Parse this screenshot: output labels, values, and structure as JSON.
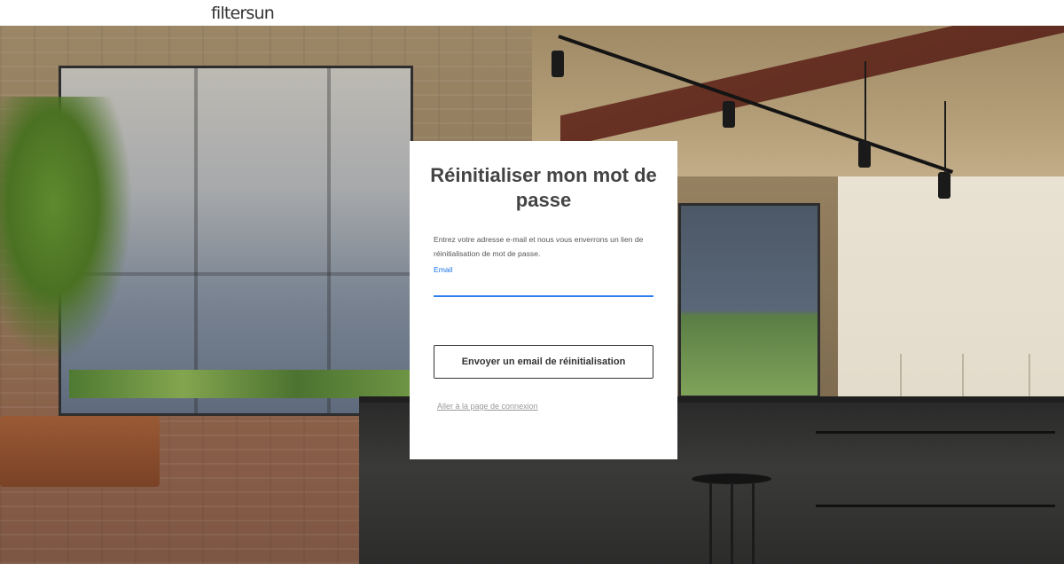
{
  "header": {
    "logo_text": "filtersun"
  },
  "reset_card": {
    "title": "Réinitialiser mon mot de passe",
    "description": "Entrez votre adresse e-mail et nous vous enverrons un lien de réinitialisation de mot de passe.",
    "email_label": "Email",
    "email_value": "",
    "send_button_label": "Envoyer un email de réinitialisation",
    "login_link_label": "Aller à la page de connexion"
  },
  "colors": {
    "accent": "#1a73e8",
    "input_underline": "#2f80ed",
    "text": "#444444",
    "link": "#999999"
  }
}
